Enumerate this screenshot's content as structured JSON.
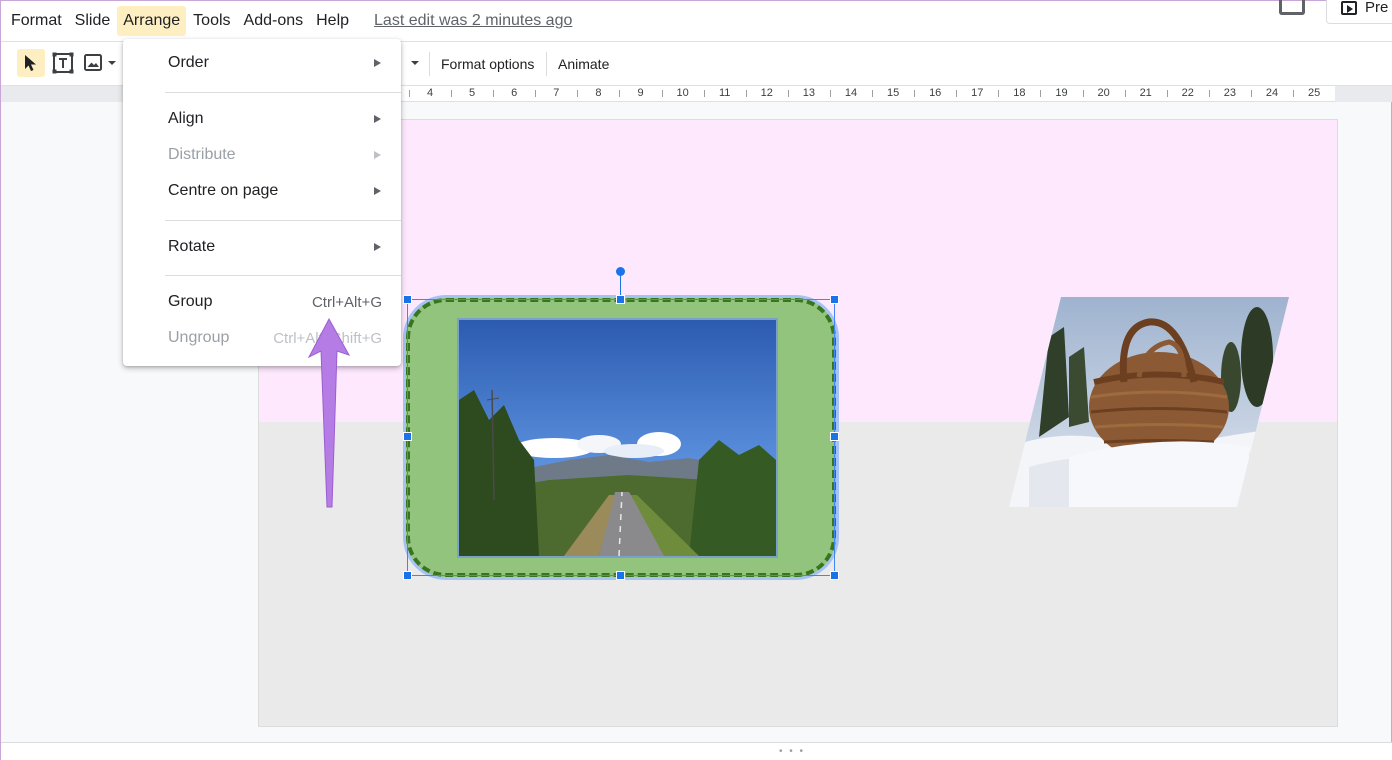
{
  "menubar": {
    "items": [
      "Format",
      "Slide",
      "Arrange",
      "Tools",
      "Add-ons",
      "Help"
    ],
    "active": "Arrange",
    "last_edit": "Last edit was 2 minutes ago",
    "present_label": "Pre"
  },
  "toolbar": {
    "format_options": "Format options",
    "animate": "Animate"
  },
  "ruler": {
    "numbers": [
      "4",
      "5",
      "6",
      "7",
      "8",
      "9",
      "10",
      "11",
      "12",
      "13",
      "14",
      "15",
      "16",
      "17",
      "18",
      "19",
      "20",
      "21",
      "22",
      "23",
      "24",
      "25"
    ]
  },
  "arrange_menu": {
    "order": "Order",
    "align": "Align",
    "distribute": "Distribute",
    "centre_on_page": "Centre on page",
    "rotate": "Rotate",
    "group": "Group",
    "group_shortcut": "Ctrl+Alt+G",
    "ungroup": "Ungroup",
    "ungroup_shortcut": "Ctrl+Alt+Shift+G"
  },
  "colors": {
    "active_menu_bg": "#feefc3",
    "selection_blue": "#1a73e8",
    "frame_green": "#93c47d",
    "frame_dash": "#38761d",
    "slide_pink": "#fde8fd",
    "annotation_purple": "#b57ce6"
  },
  "icons": {
    "select": "cursor-arrow-icon",
    "textbox": "text-box-icon",
    "image": "image-icon",
    "comments": "comments-icon",
    "present": "present-play-icon"
  }
}
